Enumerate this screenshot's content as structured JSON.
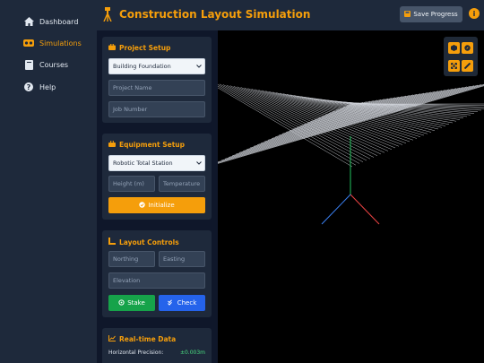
{
  "nav": [
    {
      "label": "Dashboard",
      "icon": "home-icon",
      "active": false
    },
    {
      "label": "Simulations",
      "icon": "vr-headset-icon",
      "active": true
    },
    {
      "label": "Courses",
      "icon": "book-icon",
      "active": false
    },
    {
      "label": "Help",
      "icon": "question-icon",
      "active": false
    }
  ],
  "header": {
    "title": "Construction Layout Simulation",
    "save_label": "Save Progress",
    "info_glyph": "i"
  },
  "project_setup": {
    "title": "Project Setup",
    "type_value": "Building Foundation",
    "name_placeholder": "Project Name",
    "job_placeholder": "Job Number"
  },
  "equipment_setup": {
    "title": "Equipment Setup",
    "instrument_value": "Robotic Total Station",
    "height_placeholder": "Height (m)",
    "temperature_placeholder": "Temperature",
    "initialize_label": "Initialize"
  },
  "layout_controls": {
    "title": "Layout Controls",
    "northing_placeholder": "Northing",
    "easting_placeholder": "Easting",
    "elevation_placeholder": "Elevation",
    "stake_label": "Stake",
    "check_label": "Check"
  },
  "realtime": {
    "title": "Real-time Data",
    "rows": [
      {
        "label": "Horizontal Precision:",
        "value": "±0.003m"
      }
    ]
  },
  "viewport_tools": [
    "cube-icon",
    "compass-icon",
    "expand-icon",
    "ruler-icon"
  ],
  "colors": {
    "accent": "#f59e0b",
    "sidebar": "#1e293b",
    "background": "#0f172a",
    "stake": "#16a34a",
    "check": "#2563eb",
    "value_green": "#4ade80"
  }
}
